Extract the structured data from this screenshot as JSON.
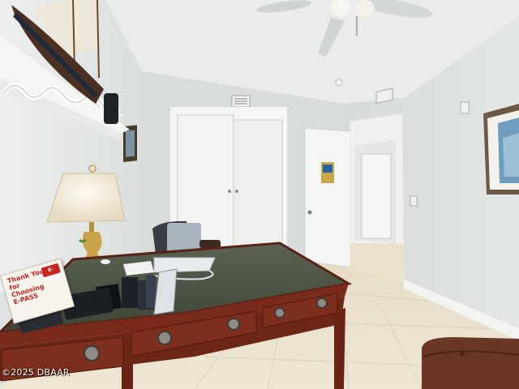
{
  "photo": {
    "subject": "home-office-bedroom",
    "watermark": "©2025 DBAAR",
    "placard_text": "Thank You\nfor Choosing\nE-PASS",
    "placard_brand": "E-PASS"
  },
  "colors": {
    "wall": "#dfe3e2",
    "ceiling": "#e9ecea",
    "floor": "#e8dcc6",
    "wood": "#7a2a1a",
    "desk_top": "#4c5443",
    "door": "#f4f4f2",
    "lamp_shade": "#ece3cf",
    "lamp_base": "#c9a24a"
  }
}
